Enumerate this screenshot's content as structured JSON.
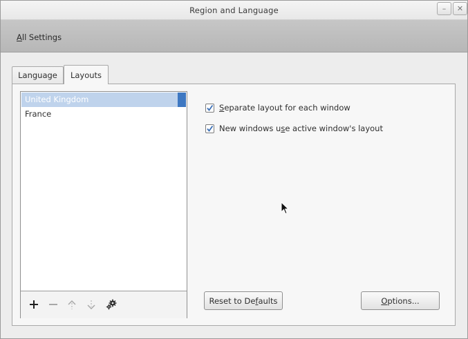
{
  "window": {
    "title": "Region and Language",
    "minimize_glyph": "–",
    "close_glyph": "✕"
  },
  "toolbar": {
    "all_settings_first": "A",
    "all_settings_rest": "ll Settings"
  },
  "tabs": [
    {
      "label": "Language",
      "selected": false
    },
    {
      "label": "Layouts",
      "selected": true
    }
  ],
  "layouts": {
    "items": [
      {
        "label": "United Kingdom",
        "selected": true
      },
      {
        "label": "France",
        "selected": false
      }
    ],
    "toolbar": {
      "add_icon": "plus-icon",
      "remove_icon": "minus-icon",
      "move_up_icon": "move-up-icon",
      "move_down_icon": "move-down-icon",
      "settings_icon": "gear-icon"
    }
  },
  "options": {
    "separate_layout": {
      "mnemonic": "S",
      "label_rest": "eparate layout for each window",
      "checked": true
    },
    "new_windows": {
      "label_before": "New windows u",
      "mnemonic": "s",
      "label_after": "e active window's layout",
      "checked": true
    }
  },
  "buttons": {
    "reset_before": "Reset to De",
    "reset_mnemonic": "f",
    "reset_after": "aults",
    "options_mnemonic": "O",
    "options_rest": "ptions..."
  },
  "colors": {
    "selection": "#bfd3ec",
    "accent": "#3e78c2",
    "check": "#3b6fb6"
  }
}
